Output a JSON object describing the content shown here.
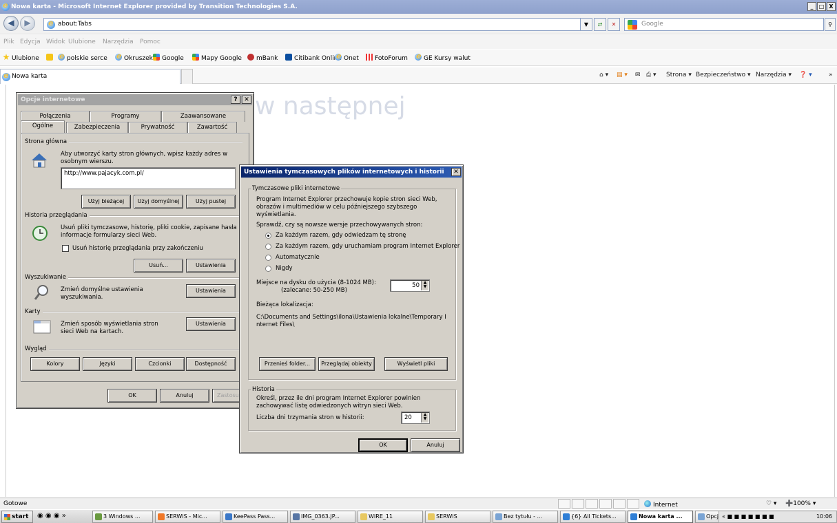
{
  "window": {
    "title": "Nowa karta - Microsoft Internet Explorer provided by Transition Technologies S.A.",
    "controls": [
      "_",
      "□",
      "X"
    ]
  },
  "address": {
    "url": "about:Tabs",
    "search_placeholder": "Google"
  },
  "menu": [
    "Plik",
    "Edycja",
    "Widok",
    "Ulubione",
    "Narzędzia",
    "Pomoc"
  ],
  "favorites": {
    "label": "Ulubione",
    "items": [
      "polskie serce",
      "Okruszek",
      "Google",
      "Mapy Google",
      "mBank",
      "Citibank Online",
      "Onet",
      "FotoForum",
      "GE Kursy walut"
    ]
  },
  "tab": {
    "title": "Nowa karta"
  },
  "commands": {
    "strona": "Strona ▾",
    "bezpieczenstwo": "Bezpieczeństwo ▾",
    "narzedzia": "Narzędzia ▾"
  },
  "page": {
    "background_text": "w następnej"
  },
  "status": {
    "left": "Gotowe",
    "zone": "Internet",
    "zoom": "100%"
  },
  "taskbar": {
    "start": "start",
    "items": [
      "3 Windows ...",
      "SERWIS - Mic...",
      "KeePass Pass...",
      "IMG_0363.JP...",
      "WIRE_11",
      "SERWIS",
      "Bez tytułu - ...",
      "{6} All Tickets...",
      "Nowa karta ...",
      "Opcje przeglą..."
    ],
    "clock": "10:06"
  },
  "options_dialog": {
    "title": "Opcje internetowe",
    "tabs_back": [
      "Połączenia",
      "Programy",
      "Zaawansowane"
    ],
    "tabs_front": [
      "Ogólne",
      "Zabezpieczenia",
      "Prywatność",
      "Zawartość"
    ],
    "home": {
      "heading": "Strona główna",
      "desc": "Aby utworzyć karty stron głównych, wpisz każdy adres w osobnym wierszu.",
      "url": "http://www.pajacyk.com.pl/",
      "buttons": [
        "Użyj bieżącej",
        "Użyj domyślnej",
        "Użyj pustej"
      ]
    },
    "history": {
      "heading": "Historia przeglądania",
      "desc": "Usuń pliki tymczasowe, historię, pliki cookie, zapisane hasła i informacje formularzy sieci Web.",
      "checkbox": "Usuń historię przeglądania przy zakończeniu",
      "delete": "Usuń...",
      "settings": "Ustawienia"
    },
    "search": {
      "heading": "Wyszukiwanie",
      "desc": "Zmień domyślne ustawienia wyszukiwania.",
      "settings": "Ustawienia"
    },
    "tabs_sec": {
      "heading": "Karty",
      "desc": "Zmień sposób wyświetlania stron sieci Web na kartach.",
      "settings": "Ustawienia"
    },
    "appearance": {
      "heading": "Wygląd",
      "buttons": [
        "Kolory",
        "Języki",
        "Czcionki",
        "Dostępność"
      ]
    },
    "footer": {
      "ok": "OK",
      "cancel": "Anuluj",
      "apply": "Zastosuj"
    }
  },
  "temp_dialog": {
    "title": "Ustawienia tymczasowych plików internetowych i historii",
    "temp": {
      "heading": "Tymczasowe pliki internetowe",
      "desc": "Program Internet Explorer przechowuje kopie stron sieci Web, obrazów i multimediów w celu późniejszego szybszego wyświetlania.",
      "check_label": "Sprawdź, czy są nowsze wersje przechowywanych stron:",
      "options": [
        "Za każdym razem, gdy odwiedzam tę stronę",
        "Za każdym razem, gdy uruchamiam program Internet Explorer",
        "Automatycznie",
        "Nigdy"
      ],
      "selected_index": 0,
      "disk_label": "Miejsce na dysku do użycia (8-1024 MB):",
      "disk_hint": "(zalecane: 50-250 MB)",
      "disk_value": "50",
      "location_label": "Bieżąca lokalizacja:",
      "location_path": "C:\\Documents and Settings\\ilona\\Ustawienia lokalne\\Temporary Internet Files\\",
      "buttons": [
        "Przenieś folder...",
        "Przeglądaj obiekty",
        "Wyświetl pliki"
      ]
    },
    "history": {
      "heading": "Historia",
      "desc": "Określ, przez ile dni program Internet Explorer powinien zachowywać listę odwiedzonych witryn sieci Web.",
      "days_label": "Liczba dni trzymania stron w historii:",
      "days_value": "20"
    },
    "ok": "OK",
    "cancel": "Anuluj"
  }
}
